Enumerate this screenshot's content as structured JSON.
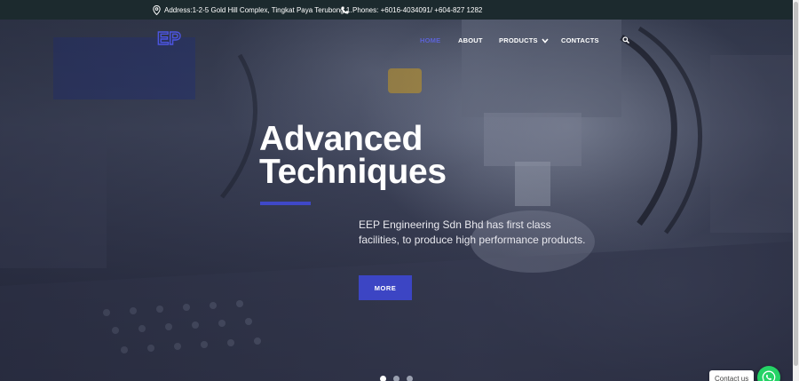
{
  "topbar": {
    "address": "Address:1-2-5 Gold Hill Complex, Tingkat Paya Terubong 1.",
    "phones": "Phones: +6016-4034091/ +604-827 1282"
  },
  "nav": {
    "logo_text": "EP",
    "home": "HOME",
    "about": "ABOUT",
    "products": "PRODUCTS",
    "contacts": "CONTACTS"
  },
  "hero": {
    "headline_line1": "Advanced",
    "headline_line2": "Techniques",
    "subtext": "EEP Engineering Sdn Bhd has first class facilities, to produce high performance products.",
    "button": "MORE",
    "slide_count": 3,
    "active_slide": 1
  },
  "contact": {
    "label": "Contact us"
  },
  "colors": {
    "accent": "#3c45c4",
    "nav_active": "#5c63d6",
    "whatsapp": "#25d366",
    "topbar_bg": "#1c2a2e"
  }
}
